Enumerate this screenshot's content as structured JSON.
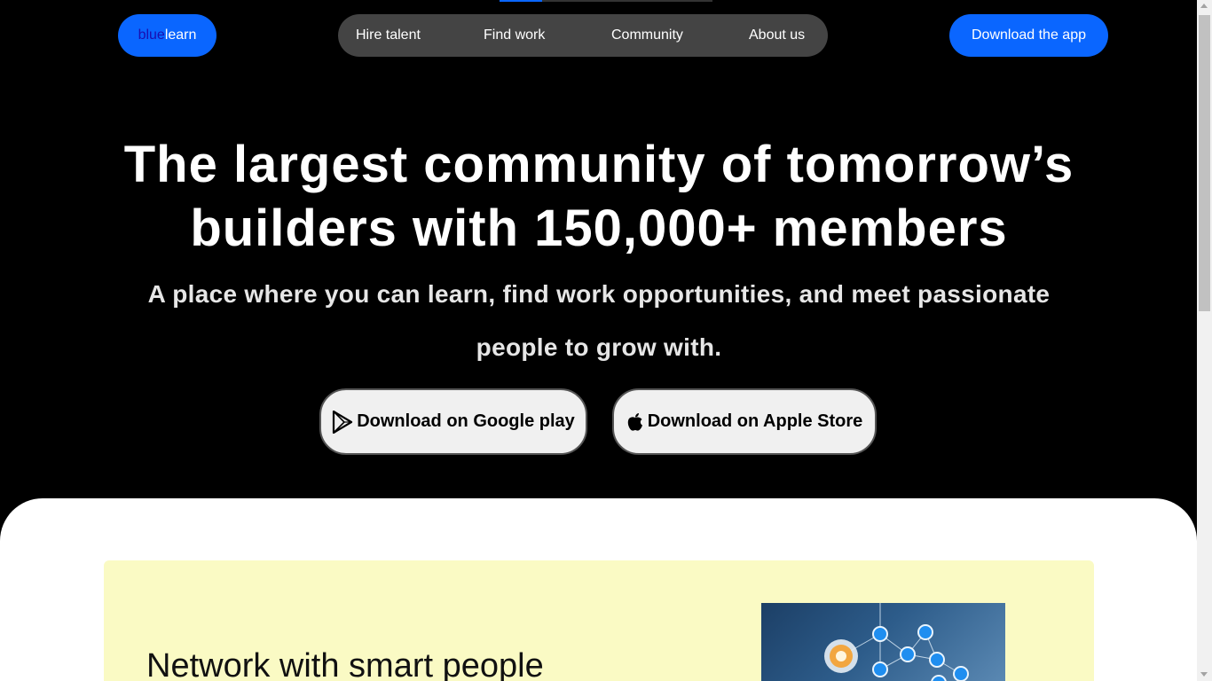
{
  "header": {
    "logo": {
      "part1": "blue",
      "part2": "learn"
    },
    "nav": [
      {
        "label": "Hire talent"
      },
      {
        "label": "Find work"
      },
      {
        "label": "Community"
      },
      {
        "label": "About us"
      }
    ],
    "cta_label": "Download the app"
  },
  "hero": {
    "title_line1": "The largest community of tomorrow’s",
    "title_line2": "builders with 150,000+ members",
    "subtitle_line1": "A place where you can learn, find work opportunities, and meet passionate",
    "subtitle_line2": "people to grow with.",
    "google_label": "Download on Google play",
    "apple_label": "Download on Apple Store"
  },
  "section": {
    "card_title": "Network with smart people"
  },
  "colors": {
    "brand": "#0a66ff",
    "background": "#000000",
    "card": "#fafac4"
  },
  "icons": [
    "play-store-icon",
    "apple-icon"
  ]
}
